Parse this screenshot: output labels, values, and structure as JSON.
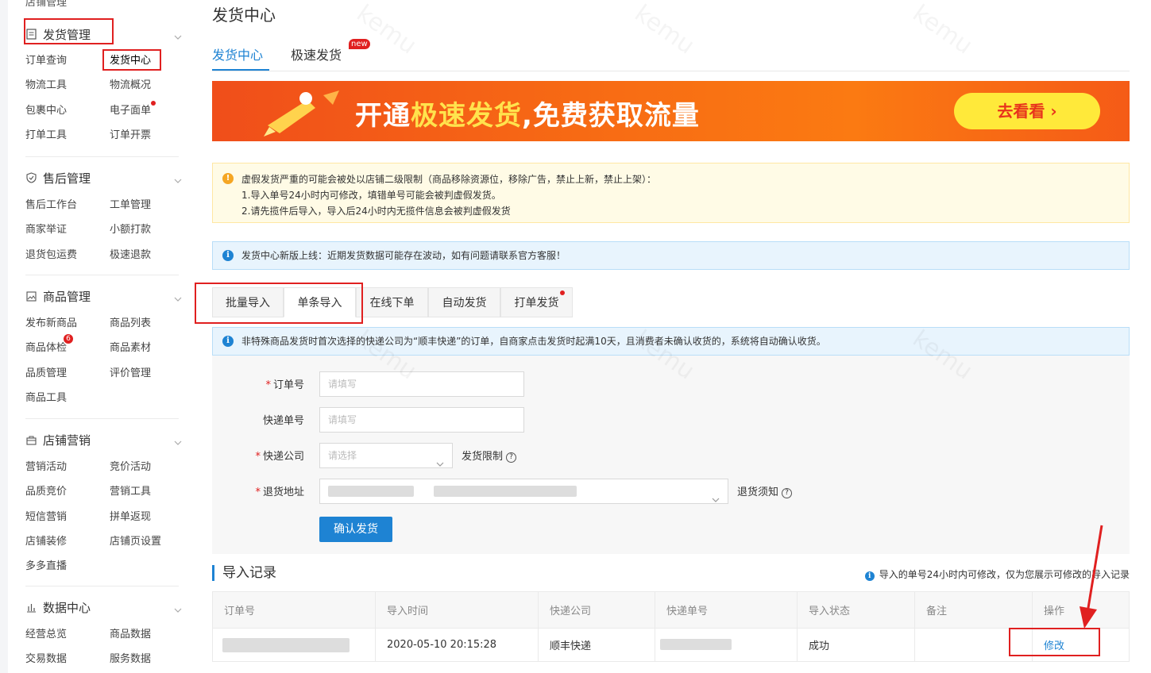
{
  "sidebar": {
    "top_cut_label": "店铺管理",
    "groups": [
      {
        "title": "发货管理",
        "icon": "document-icon",
        "items": [
          "订单查询",
          "发货中心",
          "物流工具",
          "物流概况",
          "包裹中心",
          "电子面单",
          "打单工具",
          "订单开票"
        ]
      },
      {
        "title": "售后管理",
        "icon": "shield-check-icon",
        "items": [
          "售后工作台",
          "工单管理",
          "商家举证",
          "小额打款",
          "退货包运费",
          "极速退款"
        ]
      },
      {
        "title": "商品管理",
        "icon": "image-icon",
        "items": [
          "发布新商品",
          "商品列表",
          "商品体检",
          "商品素材",
          "品质管理",
          "评价管理",
          "商品工具"
        ]
      },
      {
        "title": "店铺营销",
        "icon": "gift-icon",
        "items": [
          "营销活动",
          "竞价活动",
          "品质竞价",
          "营销工具",
          "短信营销",
          "拼单返现",
          "店铺装修",
          "店铺页设置",
          "多多直播"
        ]
      },
      {
        "title": "数据中心",
        "icon": "bar-chart-icon",
        "items": [
          "经营总览",
          "商品数据",
          "交易数据",
          "服务数据"
        ]
      }
    ],
    "badge_count": "6"
  },
  "main": {
    "page_title": "发货中心",
    "top_tabs": [
      "发货中心",
      "极速发货"
    ],
    "new_tag": "new",
    "banner": {
      "text_a": "开通",
      "text_b": "极速发货",
      "text_c": ",免费获取流量",
      "button": "去看看 ›"
    },
    "warning": {
      "line1": "虚假发货严重的可能会被处以店铺二级限制（商品移除资源位，移除广告，禁止上新，禁止上架）：",
      "line2": "1.导入单号24小时内可修改，填错单号可能会被判虚假发货。",
      "line3": "2.请先揽件后导入，导入后24小时内无揽件信息会被判虚假发货"
    },
    "info1": "发货中心新版上线：近期发货数据可能存在波动，如有问题请联系官方客服！",
    "sub_tabs": [
      "批量导入",
      "单条导入",
      "在线下单",
      "自动发货",
      "打单发货"
    ],
    "info2": "非特殊商品发货时首次选择的快递公司为“顺丰快递”的订单，自商家点击发货时起满10天，且消费者未确认收货的，系统将自动确认收货。",
    "form": {
      "order_label": "订单号",
      "order_placeholder": "请填写",
      "tracking_label": "快递单号",
      "tracking_placeholder": "请填写",
      "courier_label": "快递公司",
      "courier_placeholder": "请选择",
      "courier_note": "发货限制",
      "return_label": "退货地址",
      "return_note": "退货须知",
      "submit": "确认发货"
    },
    "records": {
      "title": "导入记录",
      "note": "导入的单号24小时内可修改，仅为您展示可修改的导入记录",
      "columns": [
        "订单号",
        "导入时间",
        "快递公司",
        "快递单号",
        "导入状态",
        "备注",
        "操作"
      ],
      "rows": [
        {
          "order": "",
          "time": "2020-05-10 20:15:28",
          "courier": "顺丰快递",
          "tracking": "",
          "status": "成功",
          "remark": "",
          "action": "修改"
        }
      ]
    },
    "watermark": "kemu"
  }
}
